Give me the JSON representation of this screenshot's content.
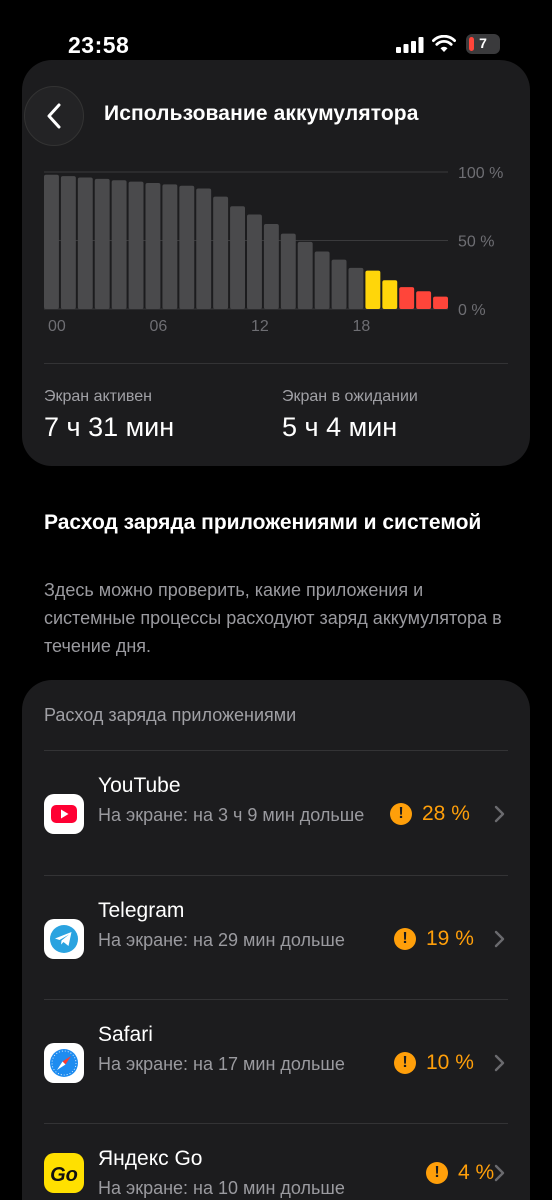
{
  "status_bar": {
    "time": "23:58",
    "battery_level": "7"
  },
  "header": {
    "title": "Использование аккумулятора"
  },
  "chart_data": {
    "type": "bar",
    "categories": [
      "00",
      "01",
      "02",
      "03",
      "04",
      "05",
      "06",
      "07",
      "08",
      "09",
      "10",
      "11",
      "12",
      "13",
      "14",
      "15",
      "16",
      "17",
      "18",
      "19",
      "20",
      "21",
      "22"
    ],
    "values": [
      98,
      97,
      96,
      95,
      94,
      93,
      92,
      91,
      90,
      88,
      82,
      75,
      69,
      62,
      55,
      49,
      42,
      36,
      30,
      28,
      21,
      16,
      13,
      9
    ],
    "x_tick_labels": [
      "00",
      "06",
      "12",
      "18"
    ],
    "y_tick_labels": [
      "100 %",
      "50 %",
      "0 %"
    ],
    "ylim": [
      0,
      100
    ],
    "bar_colors": {
      "normal": "#4a4a4c",
      "low": "#ffd60a",
      "critical": "#ff453a"
    }
  },
  "stats": {
    "screen_active_label": "Экран активен",
    "screen_active_value": "7 ч 31 мин",
    "screen_idle_label": "Экран в ожидании",
    "screen_idle_value": "5 ч 4 мин"
  },
  "section": {
    "title": "Расход заряда приложениями и системой",
    "description": "Здесь можно проверить, какие приложения и системные процессы расходуют заряд аккумулятора в течение дня."
  },
  "apps_card": {
    "header": "Расход заряда приложениями",
    "apps": [
      {
        "name": "YouTube",
        "detail": "На экране: на 3 ч 9 мин дольше",
        "percent": "28 %",
        "icon": "youtube-icon"
      },
      {
        "name": "Telegram",
        "detail": "На экране: на 29 мин дольше",
        "percent": "19 %",
        "icon": "telegram-icon"
      },
      {
        "name": "Safari",
        "detail": "На экране: на 17 мин дольше",
        "percent": "10 %",
        "icon": "safari-icon"
      },
      {
        "name": "Яндекс Go",
        "detail": "На экране: на 10 мин дольше",
        "percent": "4 %",
        "icon": "yandex-go-icon"
      }
    ],
    "warning_symbol": "!"
  }
}
